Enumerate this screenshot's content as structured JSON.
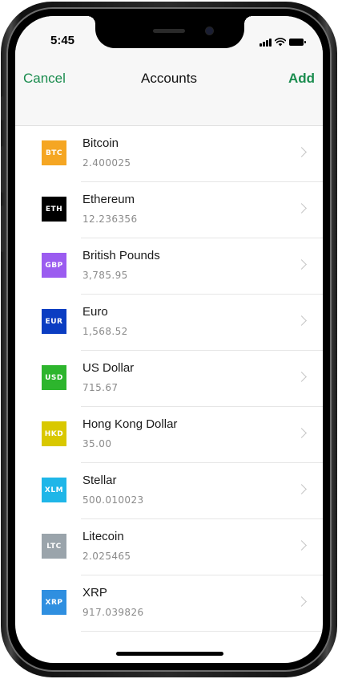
{
  "status_bar": {
    "time": "5:45",
    "icons": [
      "cellular-signal-icon",
      "wifi-icon",
      "battery-icon"
    ]
  },
  "nav": {
    "cancel_label": "Cancel",
    "title": "Accounts",
    "add_label": "Add",
    "accent_color": "#1a8c4e"
  },
  "accounts": [
    {
      "code": "BTC",
      "name": "Bitcoin",
      "balance": "2.400025",
      "color": "#f5a623"
    },
    {
      "code": "ETH",
      "name": "Ethereum",
      "balance": "12.236356",
      "color": "#000000"
    },
    {
      "code": "GBP",
      "name": "British Pounds",
      "balance": "3,785.95",
      "color": "#9b5cf0"
    },
    {
      "code": "EUR",
      "name": "Euro",
      "balance": "1,568.52",
      "color": "#0b3dc2"
    },
    {
      "code": "USD",
      "name": "US Dollar",
      "balance": "715.67",
      "color": "#2db52d"
    },
    {
      "code": "HKD",
      "name": "Hong Kong Dollar",
      "balance": "35.00",
      "color": "#d9c800"
    },
    {
      "code": "XLM",
      "name": "Stellar",
      "balance": "500.010023",
      "color": "#1fb6e8"
    },
    {
      "code": "LTC",
      "name": "Litecoin",
      "balance": "2.025465",
      "color": "#9aa4ab"
    },
    {
      "code": "XRP",
      "name": "XRP",
      "balance": "917.039826",
      "color": "#2f8fe0"
    }
  ]
}
